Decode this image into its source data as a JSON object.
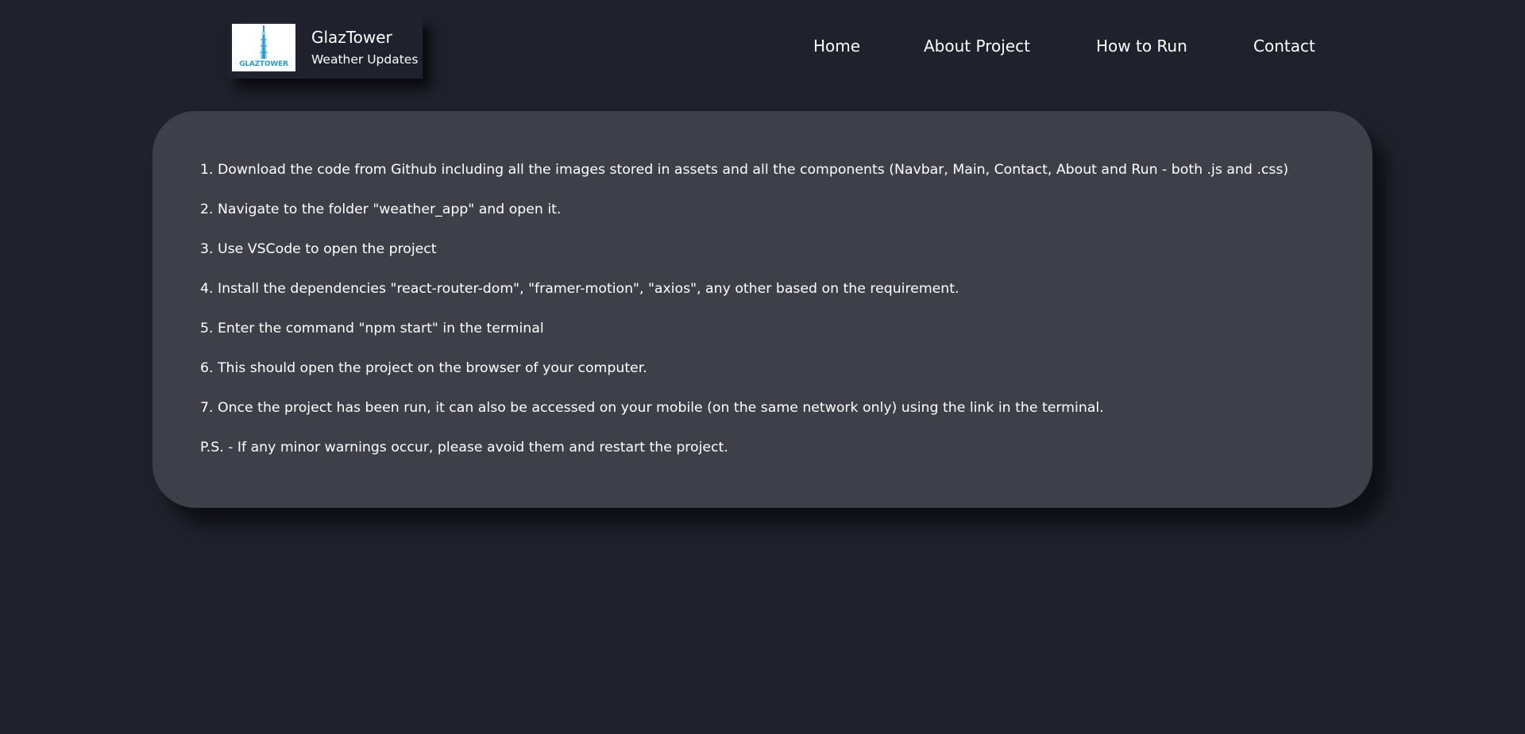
{
  "brand": {
    "title": "GlazTower",
    "subtitle": "Weather Updates",
    "logo_text": "GLAZTOWER",
    "logo_icon": "tower-icon",
    "logo_color": "#2a9bd3"
  },
  "nav": {
    "home": "Home",
    "about": "About Project",
    "run": "How to Run",
    "contact": "Contact"
  },
  "instructions": [
    "1. Download the code from Github including all the images stored in assets and all the components (Navbar, Main, Contact, About and Run - both .js and .css)",
    "2. Navigate to the folder \"weather_app\" and open it.",
    "3. Use VSCode to open the project",
    "4. Install the dependencies \"react-router-dom\", \"framer-motion\", \"axios\", any other based on the requirement.",
    "5. Enter the command \"npm start\" in the terminal",
    "6. This should open the project on the browser of your computer.",
    "7. Once the project has been run, it can also be accessed on your mobile (on the same network only) using the link in the terminal.",
    "P.S. - If any minor warnings occur, please avoid them and restart the project."
  ],
  "colors": {
    "background": "#1f212c",
    "card": "#3f3f4a",
    "text": "#ffffff"
  }
}
